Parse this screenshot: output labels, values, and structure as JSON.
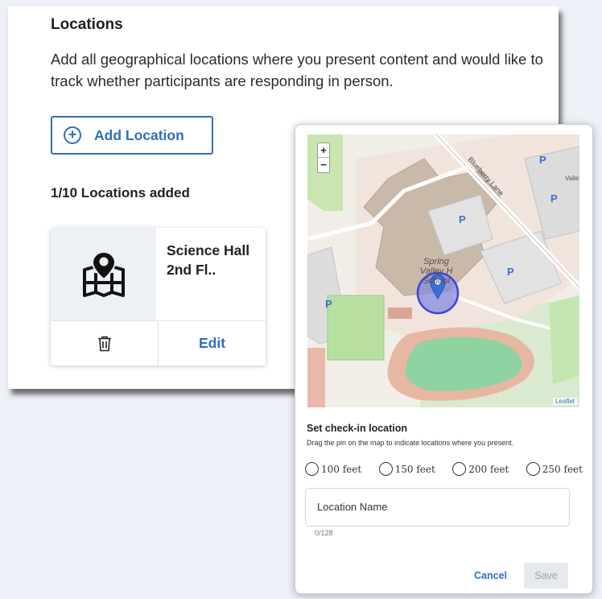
{
  "locations_panel": {
    "title": "Locations",
    "description": "Add all geographical locations where you present content and would like to track whether participants are responding in person.",
    "add_button_label": "Add Location",
    "count_text": "1/10 Locations added",
    "card": {
      "icon": "map-pin-icon",
      "name": "Science Hall 2nd Fl..",
      "edit_label": "Edit",
      "delete_icon": "trash-icon"
    }
  },
  "modal": {
    "map": {
      "zoom_in": "+",
      "zoom_out": "−",
      "street_label": "Blueberry Lane",
      "parking_label": "P",
      "school_line1": "Spring",
      "school_line2": "Valley H",
      "school_line3": "School",
      "valle_label": "Valle",
      "attribution": "Leaflet"
    },
    "title": "Set check-in location",
    "subtitle": "Drag the pin on the map to indicate locations where you present.",
    "radius_options": [
      "100 feet",
      "150 feet",
      "200 feet",
      "250 feet"
    ],
    "location_name_placeholder": "Location Name",
    "char_count": "0/128",
    "cancel_label": "Cancel",
    "save_label": "Save"
  },
  "colors": {
    "accent": "#2f6fbd",
    "pin": "#3b6fd6",
    "geofence": "#7f84e0"
  }
}
